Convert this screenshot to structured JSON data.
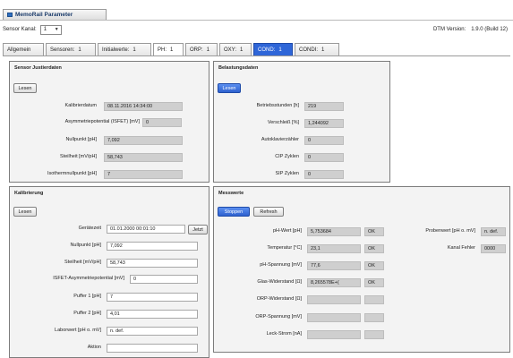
{
  "window": {
    "title": "MemoRail Parameter"
  },
  "header": {
    "sensor_kanal_label": "Sensor Kanal:",
    "sensor_kanal_value": "1",
    "dtm_label": "DTM Version:",
    "dtm_value": "1.9.0 (Build 12)"
  },
  "tabs": [
    {
      "label": "Allgemein"
    },
    {
      "label": "Sensoren:",
      "badge": "1"
    },
    {
      "label": "Initialwerte:",
      "badge": "1"
    },
    {
      "label": "PH:",
      "badge": "1"
    },
    {
      "label": "ORP:",
      "badge": "1"
    },
    {
      "label": "OXY:",
      "badge": "1"
    },
    {
      "label": "COND:",
      "badge": "1"
    },
    {
      "label": "CONDI:",
      "badge": "1"
    }
  ],
  "sensor_justierdaten": {
    "title": "Sensor Justierdaten",
    "lesen": "Lesen",
    "rows": [
      {
        "label": "Kalibrierdatum",
        "value": "08.11.2016 14:34:00"
      },
      {
        "label": "Asymmetriepotential (ISFET) [mV]",
        "value": "0"
      },
      {
        "label": "Nullpunkt [pH]",
        "value": "7,092"
      },
      {
        "label": "Steilheit [mV/pH]",
        "value": "58,743"
      },
      {
        "label": "Isothermnullpunkt [pH]",
        "value": "7"
      }
    ]
  },
  "belastungsdaten": {
    "title": "Belastungsdaten",
    "lesen": "Lesen",
    "rows": [
      {
        "label": "Betriebsstunden [h]",
        "value": "219"
      },
      {
        "label": "Verschleiß [%]",
        "value": "1,244092"
      },
      {
        "label": "Autoklavierzähler",
        "value": "0"
      },
      {
        "label": "CIP Zyklen",
        "value": "0"
      },
      {
        "label": "SIP Zyklen",
        "value": "0"
      }
    ]
  },
  "kalibrierung": {
    "title": "Kalibrierung",
    "lesen": "Lesen",
    "jetzt": "Jetzt",
    "rows": [
      {
        "label": "Gerätezeit",
        "value": "01.01.2000 00:01:10"
      },
      {
        "label": "Nullpunkt [pH]",
        "value": "7,092"
      },
      {
        "label": "Steilheit [mV/pH]",
        "value": "58,743"
      },
      {
        "label": "ISFET-Asymmetriepotential [mV]",
        "value": "0"
      },
      {
        "label": "Puffer 1 [pH]",
        "value": "7"
      },
      {
        "label": "Puffer 2 [pH]",
        "value": "4,01"
      },
      {
        "label": "Laborwert [pH o. mV]",
        "value": "n. def."
      },
      {
        "label": "Aktion",
        "value": ""
      }
    ]
  },
  "messwerte": {
    "title": "Messwerte",
    "stoppen": "Stoppen",
    "refresh": "Refresh",
    "rows": [
      {
        "label": "pH-Wert [pH]",
        "value": "5,753684",
        "status": "OK"
      },
      {
        "label": "Temperatur [°C]",
        "value": "23,1",
        "status": "OK"
      },
      {
        "label": "pH-Spannung [mV]",
        "value": "77,6",
        "status": "OK"
      },
      {
        "label": "Glas-Widerstand [Ω]",
        "value": "8,265578E+(",
        "status": "OK"
      },
      {
        "label": "ORP-Widerstand [Ω]",
        "value": "",
        "status": ""
      },
      {
        "label": "ORP-Spannung [mV]",
        "value": "",
        "status": ""
      },
      {
        "label": "Leck-Strom [nA]",
        "value": "",
        "status": ""
      }
    ],
    "probenwert_label": "Probenwert [pH o. mV]",
    "probenwert_value": "n. def.",
    "kanal_fehler_label": "Kanal Fehler",
    "kanal_fehler_value": "0000"
  },
  "colors": {
    "tab_active": "#2f66d8",
    "field_readonly": "#cfcfcf",
    "panel_bg": "#f3f3f3"
  }
}
